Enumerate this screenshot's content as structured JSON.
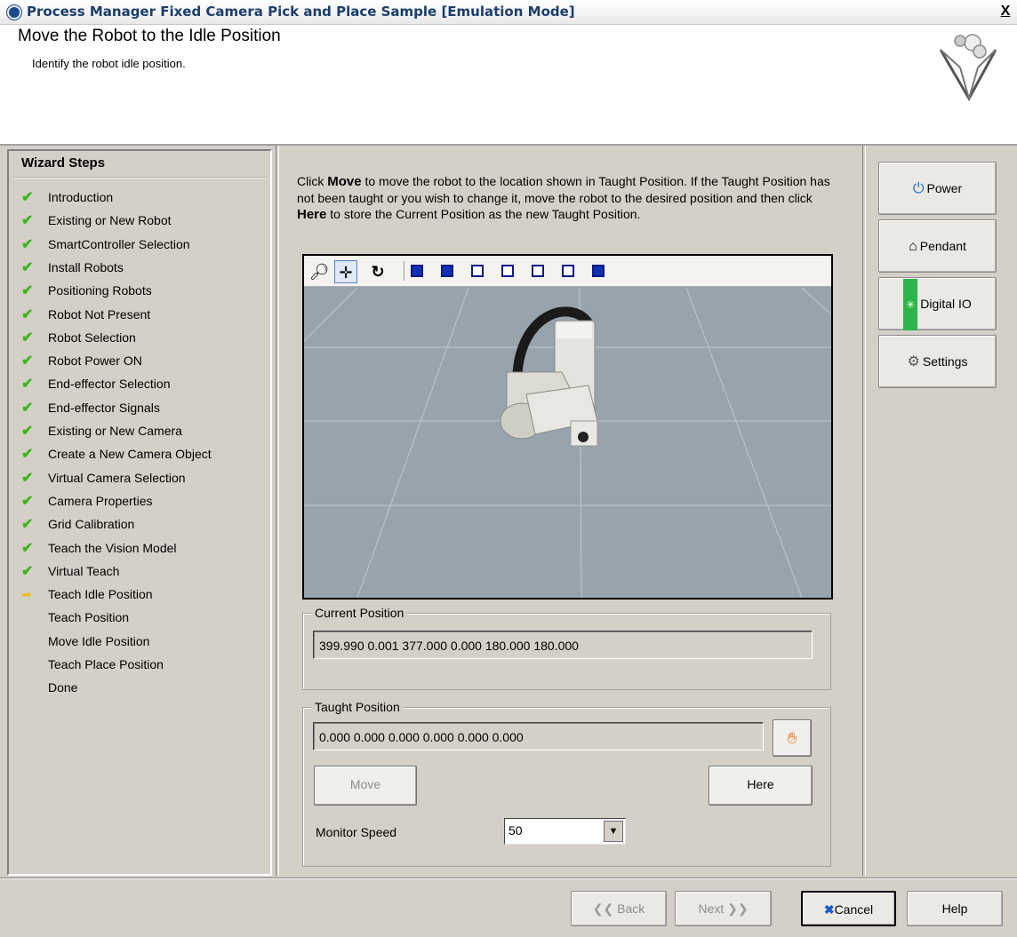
{
  "window": {
    "title": "Process Manager Fixed Camera Pick and Place Sample [Emulation Mode]",
    "close_label": "X"
  },
  "header": {
    "title": "Move the Robot to the Idle Position",
    "subtitle": "Identify the robot idle position."
  },
  "sidebar": {
    "title": "Wizard Steps",
    "steps": [
      {
        "label": "Introduction",
        "status": "done"
      },
      {
        "label": "Existing or New Robot",
        "status": "done"
      },
      {
        "label": "SmartController Selection",
        "status": "done"
      },
      {
        "label": "Install Robots",
        "status": "done"
      },
      {
        "label": "Positioning Robots",
        "status": "done"
      },
      {
        "label": "Robot Not Present",
        "status": "done"
      },
      {
        "label": "Robot Selection",
        "status": "done"
      },
      {
        "label": "Robot Power ON",
        "status": "done"
      },
      {
        "label": "End-effector Selection",
        "status": "done"
      },
      {
        "label": "End-effector Signals",
        "status": "done"
      },
      {
        "label": "Existing or New Camera",
        "status": "done"
      },
      {
        "label": "Create a New Camera Object",
        "status": "done"
      },
      {
        "label": "Virtual Camera Selection",
        "status": "done"
      },
      {
        "label": "Camera Properties",
        "status": "done"
      },
      {
        "label": "Grid Calibration",
        "status": "done"
      },
      {
        "label": "Teach the Vision Model",
        "status": "done"
      },
      {
        "label": "Virtual Teach",
        "status": "done"
      },
      {
        "label": "Teach Idle Position",
        "status": "current"
      },
      {
        "label": "Teach Position",
        "status": "pending"
      },
      {
        "label": "Move Idle Position",
        "status": "pending"
      },
      {
        "label": "Teach Place Position",
        "status": "pending"
      },
      {
        "label": "Done",
        "status": "pending"
      }
    ]
  },
  "instructions": {
    "part1": "Click ",
    "move_word": "Move",
    "part2": " to move the robot to the location shown in Taught Position. If the Taught Position has not been taught or you wish to change it, move the robot to the desired position and then click ",
    "here_word": "Here",
    "part3": " to store the Current Position as the new Taught Position."
  },
  "current_position": {
    "label": "Current Position",
    "value": "399.990 0.001 377.000 0.000 180.000 180.000"
  },
  "taught_position": {
    "label": "Taught Position",
    "value": "0.000 0.000 0.000 0.000 0.000 0.000",
    "move_label": "Move",
    "here_label": "Here",
    "speed_label": "Monitor Speed",
    "speed_value": "50"
  },
  "right_panel": {
    "power_label": "Power",
    "pendant_label": "Pendant",
    "digital_io_label": "Digital IO",
    "settings_label": "Settings"
  },
  "footer": {
    "back_label": "Back",
    "next_label": "Next",
    "cancel_label": "Cancel",
    "help_label": "Help"
  },
  "colors": {
    "check": "#3bb51a",
    "current_arrow": "#e8c02a",
    "viewer_floor": "#97a3ad"
  }
}
